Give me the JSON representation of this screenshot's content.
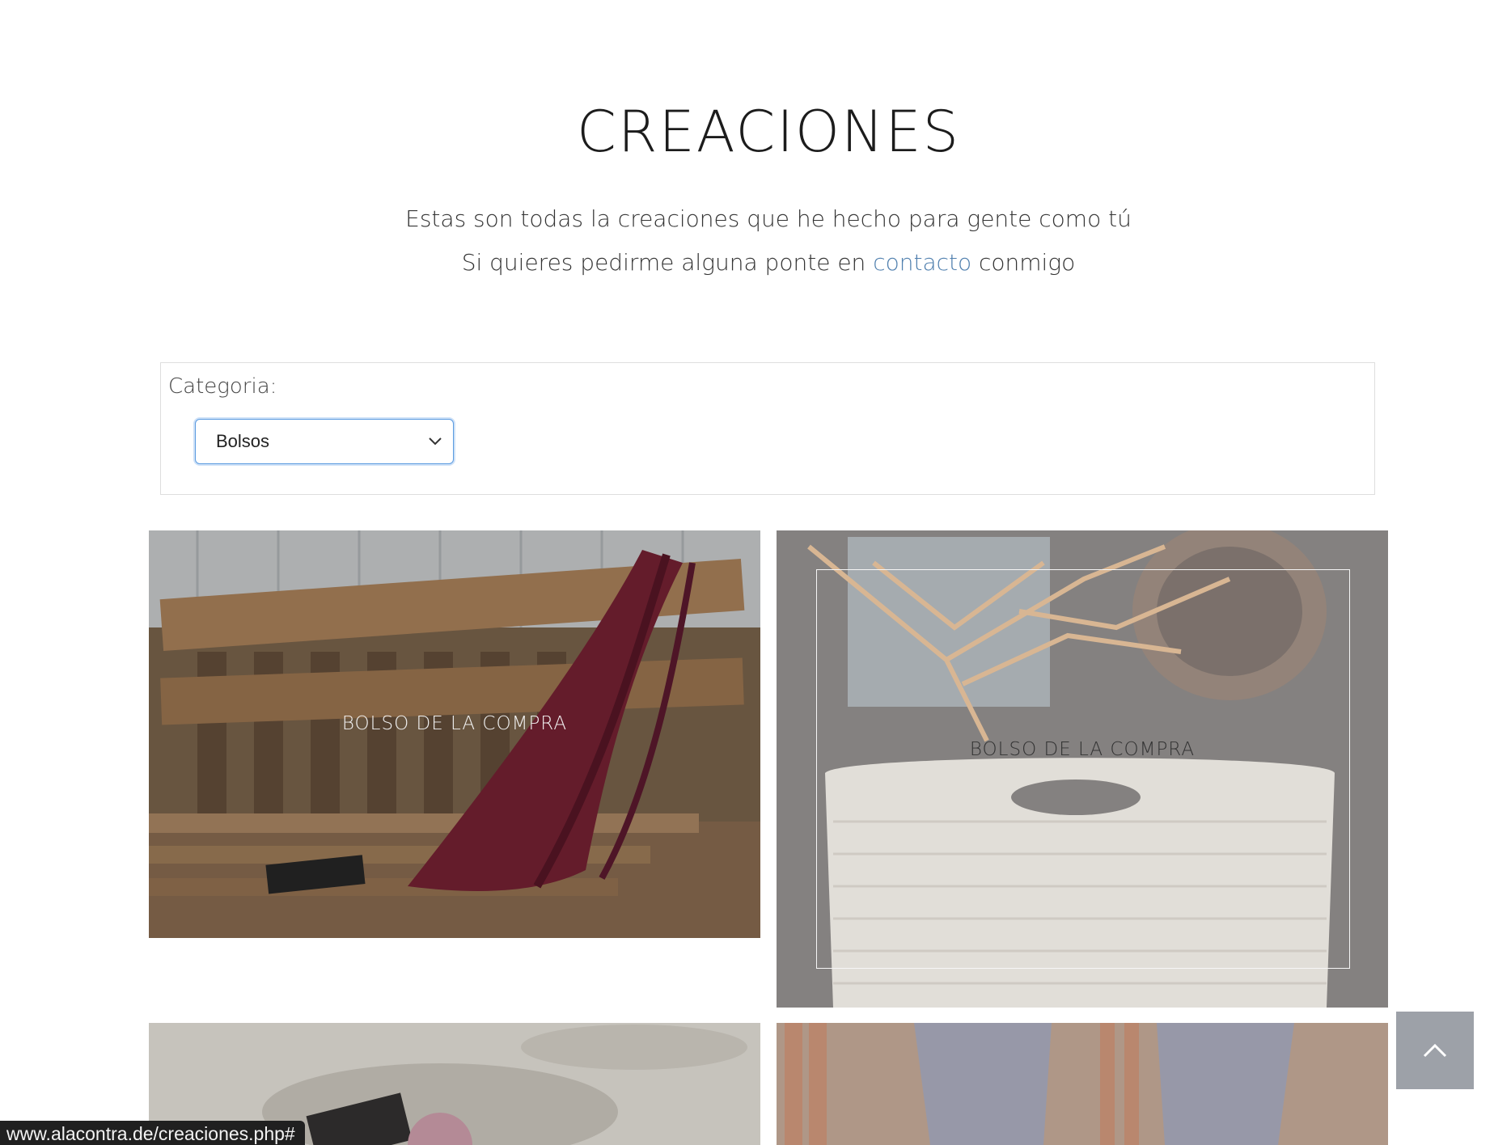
{
  "header": {
    "title": "CREACIONES"
  },
  "intro": {
    "line1": "Estas son todas la creaciones que he hecho para gente como tú",
    "line2_before": "Si quieres pedirme alguna ponte en ",
    "line2_link": "contacto",
    "line2_after": " conmigo"
  },
  "filter": {
    "label": "Categoria:",
    "selected": "Bolsos"
  },
  "gallery": {
    "items": [
      {
        "label": "BOLSO DE LA COMPRA"
      },
      {
        "label": "BOLSO DE LA COMPRA"
      },
      {
        "label": ""
      },
      {
        "label": ""
      }
    ]
  },
  "status_bar": {
    "url": "www.alacontra.de/creaciones.php#"
  },
  "icons": {
    "select": "chevron-down-icon",
    "scroll_top": "chevron-up-icon"
  },
  "colors": {
    "link": "#4f7fae",
    "select_focus": "#5b9be0",
    "scroll_button": "#9da1a8"
  }
}
